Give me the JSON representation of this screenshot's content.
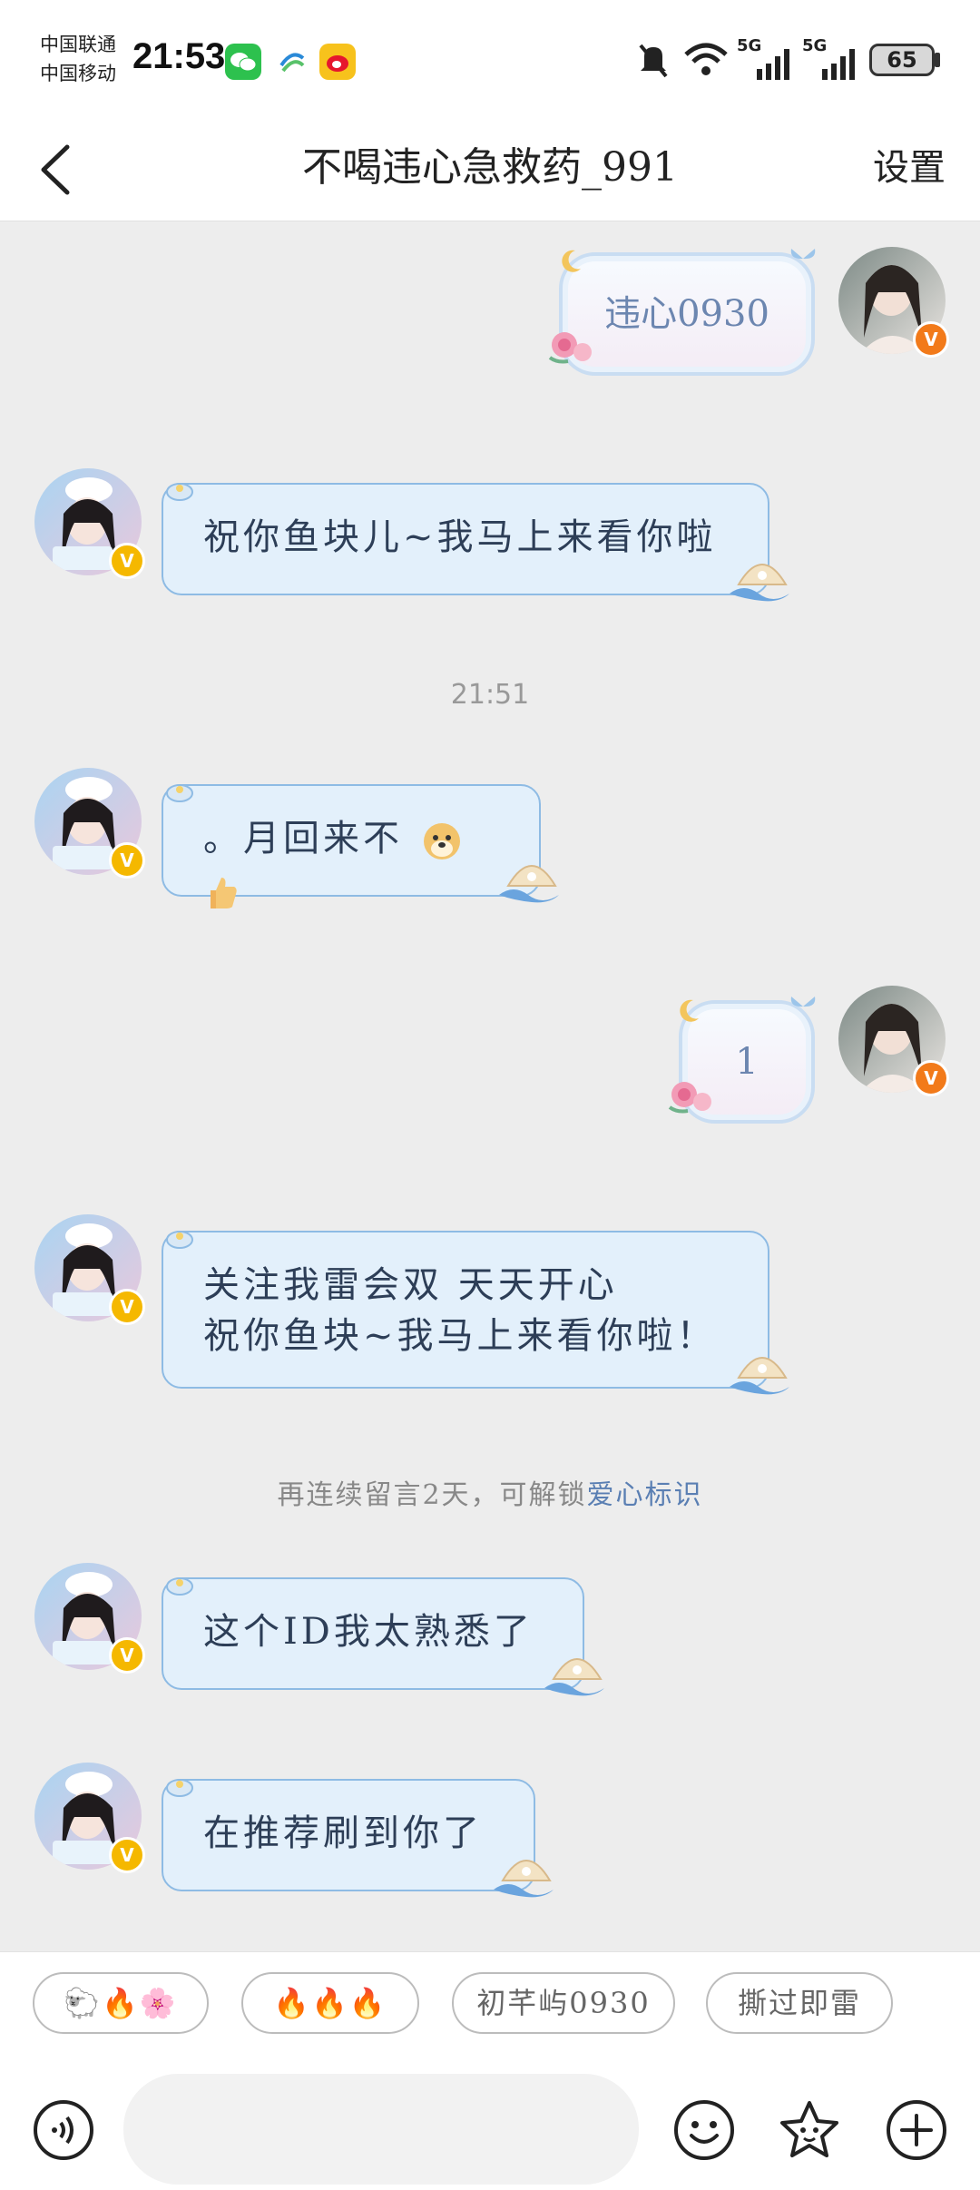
{
  "status_bar": {
    "carrier1": "中国联通",
    "carrier2": "中国移动",
    "time": "21:53",
    "signal1": "5G",
    "signal2": "5G",
    "battery": "65"
  },
  "nav": {
    "title": "不喝违心急救药_991",
    "settings": "设置"
  },
  "messages": [
    {
      "side": "right",
      "text": "违心0930"
    },
    {
      "side": "left",
      "text": "祝你鱼块儿~我马上来看你啦"
    },
    {
      "type": "timestamp",
      "text": "21:51"
    },
    {
      "side": "left",
      "text": "。月回来不"
    },
    {
      "side": "right",
      "text": "1"
    },
    {
      "side": "left",
      "line1": "关注我雷会双 天天开心",
      "line2": "祝你鱼块~我马上来看你啦！"
    },
    {
      "type": "system",
      "text": "再连续留言2天，可解锁",
      "highlight": "爱心标识"
    },
    {
      "side": "left",
      "text": "这个ID我太熟悉了"
    },
    {
      "side": "left",
      "text": "在推荐刷到你了"
    }
  ],
  "quick_replies": [
    {
      "text": "🐑🔥🌸"
    },
    {
      "text": "🔥🔥🔥"
    },
    {
      "text": "初芊屿0930"
    },
    {
      "text": "撕过即雷"
    }
  ],
  "colors": {
    "bubble_left_bg": "#e3f0fb",
    "bubble_left_border": "#8ebbe4",
    "badge_orange": "#f27a1a",
    "badge_yellow": "#f5b800"
  }
}
